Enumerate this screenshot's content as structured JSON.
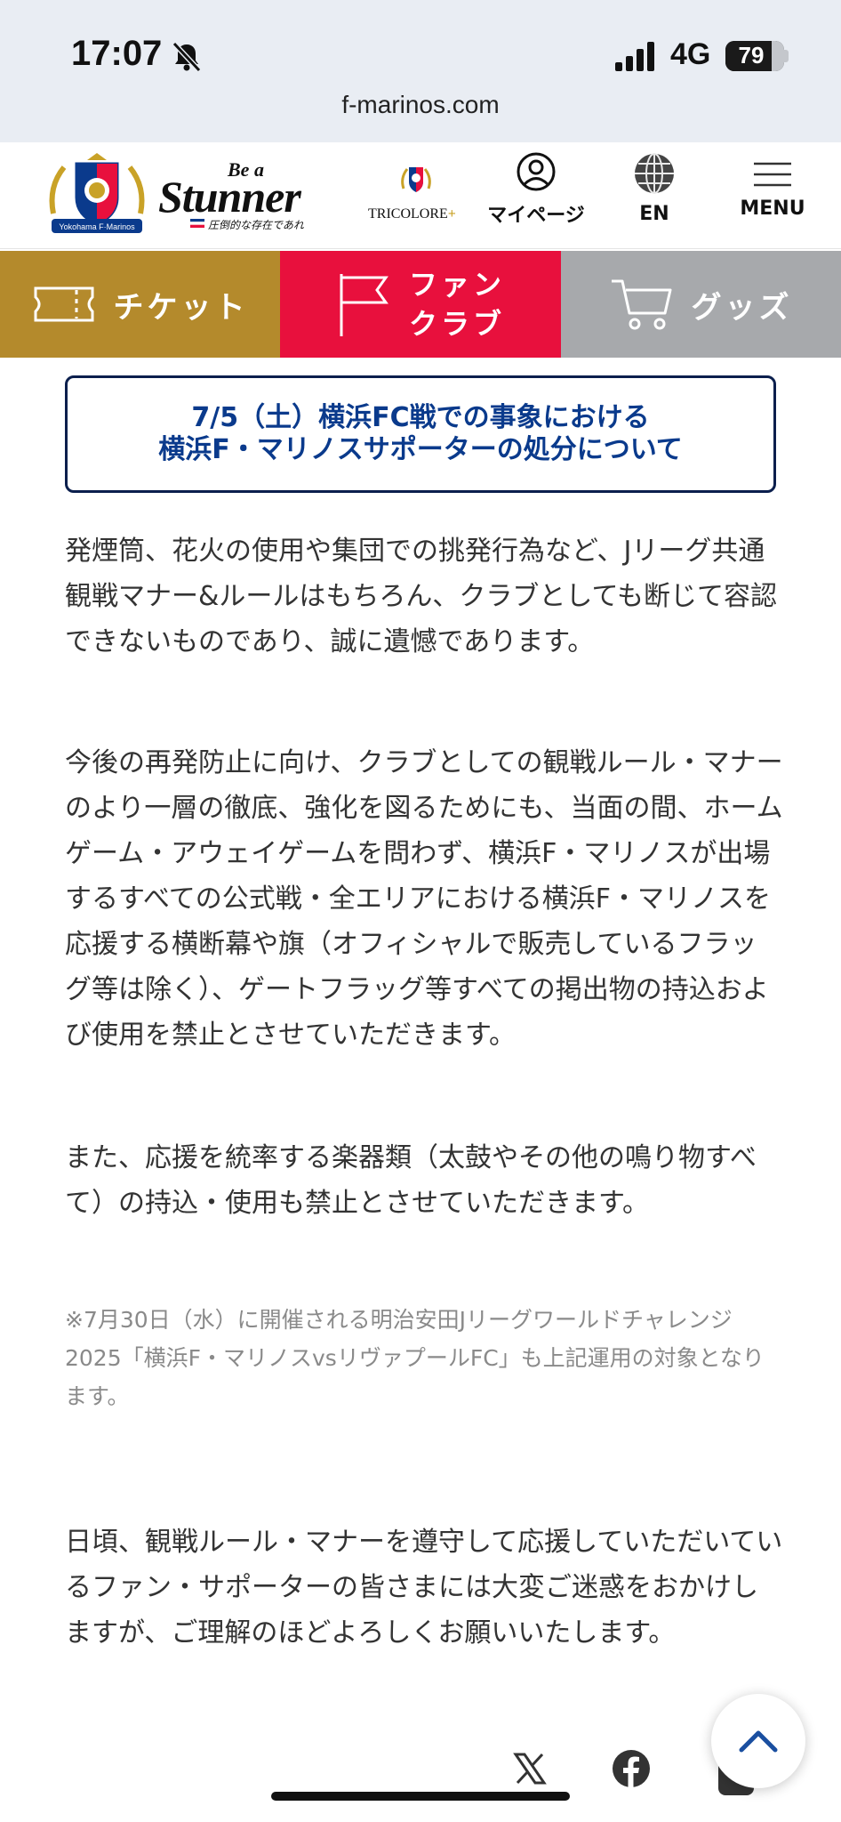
{
  "status_bar": {
    "time": "17:07",
    "network": "4G",
    "battery": "79",
    "battery_level": 0.79
  },
  "browser": {
    "url": "f-marinos.com"
  },
  "header": {
    "slogan_top": "Be a",
    "slogan_main": "Stunner",
    "slogan_sub": "圧倒的な存在であれ",
    "tricolore_text": "TRICOLORE",
    "tricolore_plus": "+",
    "mypage_label": "マイページ",
    "en_label": "EN",
    "menu_label": "MENU"
  },
  "nav": {
    "ticket": "チケット",
    "fan_line1": "ファン",
    "fan_line2": "クラブ",
    "goods": "グッズ"
  },
  "article": {
    "title_line1": "7/5（土）横浜FC戦での事象における",
    "title_line2": "横浜F・マリノスサポーターの処分について",
    "para1": "発煙筒、花火の使用や集団での挑発行為など、Jリーグ共通観戦マナー&ルールはもちろん、クラブとしても断じて容認できないものであり、誠に遺憾であります。",
    "para2": "今後の再発防止に向け、クラブとしての観戦ルール・マナーのより一層の徹底、強化を図るためにも、当面の間、ホームゲーム・アウェイゲームを問わず、横浜F・マリノスが出場するすべての公式戦・全エリアにおける横浜F・マリノスを応援する横断幕や旗（オフィシャルで販売しているフラッグ等は除く）、ゲートフラッグ等すべての掲出物の持込および使用を禁止とさせていただきます。",
    "para3": "また、応援を統率する楽器類（太鼓やその他の鳴り物すべて）の持込・使用も禁止とさせていただきます。",
    "note": "※7月30日（水）に開催される明治安田Jリーグワールドチャレンジ2025「横浜F・マリノスvsリヴァプールFC」も上記運用の対象となります。",
    "para4": "日頃、観戦ルール・マナーを遵守して応援していただいているファン・サポーターの皆さまには大変ご迷惑をおかけしますが、ご理解のほどよろしくお願いいたします。"
  },
  "colors": {
    "ticket": "#b48a2c",
    "fanclub": "#e8103d",
    "goods": "#a7a9ac",
    "title": "#0a3a8c",
    "title_border": "#0b1f4d",
    "back_top_arrow": "#1a4fa0"
  },
  "icons": {
    "bell": "bell-slash-icon",
    "signal": "cellular-signal-icon",
    "mypage": "user-circle-icon",
    "en": "globe-icon",
    "menu": "hamburger-icon",
    "ticket": "ticket-icon",
    "fan": "flag-icon",
    "goods": "cart-icon",
    "share_x": "x-logo-icon",
    "share_fb": "facebook-icon",
    "back_top": "chevron-up-icon"
  }
}
